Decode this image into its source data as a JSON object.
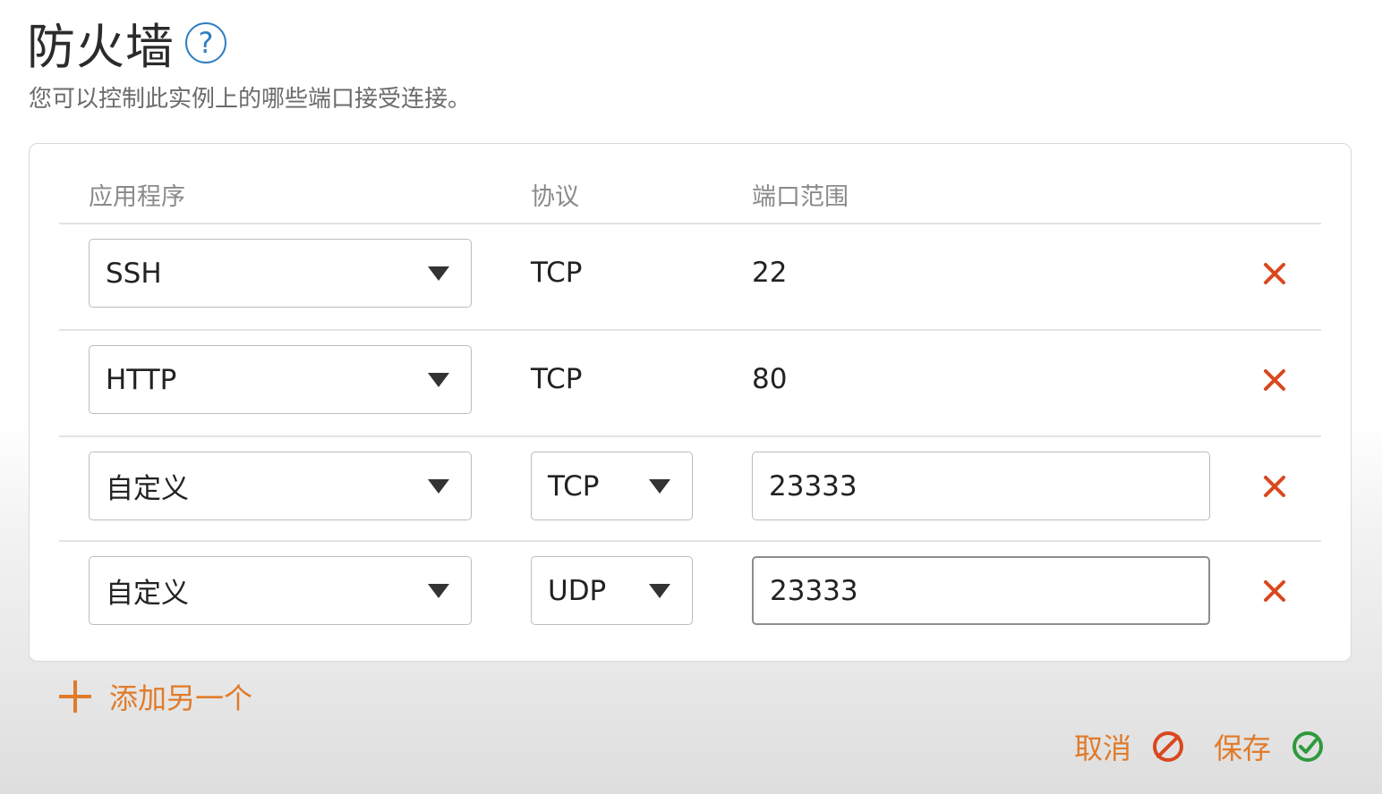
{
  "header": {
    "title": "防火墙",
    "help_label": "?",
    "subtitle": "您可以控制此实例上的哪些端口接受连接。"
  },
  "columns": {
    "application": "应用程序",
    "protocol": "协议",
    "port_range": "端口范围"
  },
  "rules": [
    {
      "application": "SSH",
      "protocol": "TCP",
      "port": "22",
      "editable": false
    },
    {
      "application": "HTTP",
      "protocol": "TCP",
      "port": "80",
      "editable": false
    },
    {
      "application": "自定义",
      "protocol": "TCP",
      "port": "23333",
      "editable": true
    },
    {
      "application": "自定义",
      "protocol": "UDP",
      "port": "23333",
      "editable": true
    }
  ],
  "actions": {
    "add_another": "添加另一个",
    "cancel": "取消",
    "save": "保存"
  },
  "colors": {
    "accent": "#e07b2a",
    "help": "#2f7fc2",
    "success": "#2e9a3e",
    "danger": "#d9481e"
  },
  "icons": {
    "help": "question-circle-icon",
    "dropdown": "caret-down-icon",
    "delete": "close-x-icon",
    "add": "plus-icon",
    "cancel": "circle-slash-icon",
    "save": "check-circle-icon"
  }
}
